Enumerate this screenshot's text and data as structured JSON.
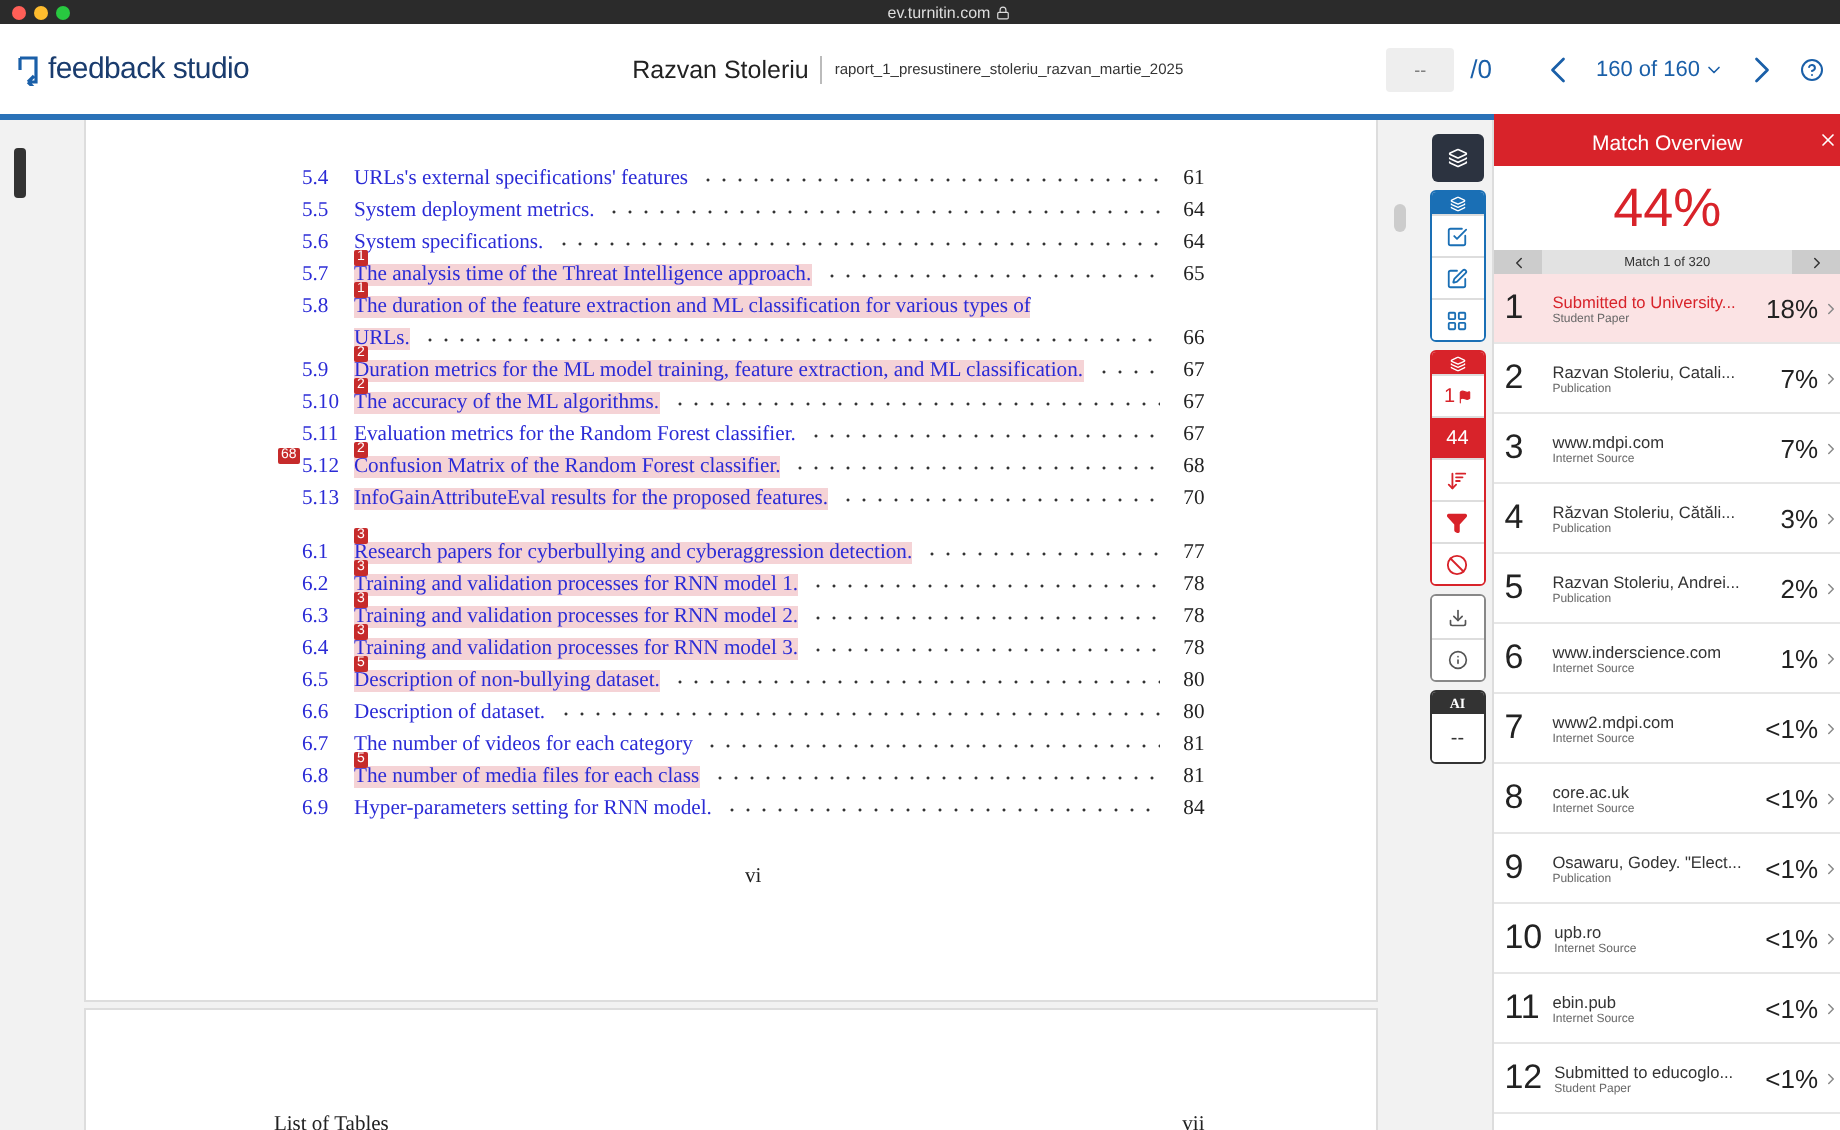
{
  "browser": {
    "url": "ev.turnitin.com"
  },
  "header": {
    "logo": "feedback studio",
    "author": "Razvan Stoleriu",
    "file": "raport_1_presustinere_stoleriu_razvan_martie_2025",
    "page_field": "--",
    "page_total": "/0",
    "paper_counter": "160 of 160"
  },
  "document": {
    "sections": [
      {
        "rows": [
          {
            "number": "5.4",
            "title": "URLs's external specifications' features",
            "page": "61",
            "highlighted": false
          },
          {
            "number": "5.5",
            "title": "System deployment metrics.",
            "page": "64",
            "highlighted": false
          },
          {
            "number": "5.6",
            "title": "System specifications.",
            "page": "64",
            "highlighted": false
          },
          {
            "number": "5.7",
            "title": "The analysis time of the Threat Intelligence approach.",
            "page": "65",
            "highlighted": true,
            "badges": [
              "1"
            ]
          },
          {
            "number": "5.8",
            "title": "The duration of the feature extraction and ML classification for various types of",
            "continuation": "URLs.",
            "page": "66",
            "highlighted": true,
            "badges": [
              "1"
            ]
          },
          {
            "number": "5.9",
            "title": "Duration metrics for the ML model training, feature extraction, and ML classification.",
            "page": "67",
            "highlighted": true,
            "badges": [
              "2"
            ]
          },
          {
            "number": "5.10",
            "title": "The accuracy of the ML algorithms.",
            "page": "67",
            "highlighted": true,
            "badges": [
              "2"
            ]
          },
          {
            "number": "5.11",
            "title": "Evaluation metrics for the Random Forest classifier.",
            "page": "67",
            "highlighted": false
          },
          {
            "number": "5.12",
            "title": "Confusion Matrix of the Random Forest classifier.",
            "page": "68",
            "highlighted": true,
            "number_badge": "68",
            "badges": [
              "2"
            ]
          },
          {
            "number": "5.13",
            "title": "InfoGainAttributeEval results for the proposed features.",
            "page": "70",
            "highlighted": true
          }
        ]
      },
      {
        "rows": [
          {
            "number": "6.1",
            "title": "Research papers for cyberbullying and cyberaggression detection.",
            "page": "77",
            "highlighted": true,
            "badges": [
              "3"
            ]
          },
          {
            "number": "6.2",
            "title": "Training and validation processes for RNN model 1.",
            "page": "78",
            "highlighted": true,
            "badges": [
              "3"
            ]
          },
          {
            "number": "6.3",
            "title": "Training and validation processes for RNN model 2.",
            "page": "78",
            "highlighted": true,
            "badges": [
              "3"
            ]
          },
          {
            "number": "6.4",
            "title": "Training and validation processes for RNN model 3.",
            "page": "78",
            "highlighted": true,
            "badges": [
              "3"
            ]
          },
          {
            "number": "6.5",
            "title": "Description of non-bullying dataset.",
            "page": "80",
            "highlighted": true,
            "badges": [
              "5"
            ]
          },
          {
            "number": "6.6",
            "title": "Description of dataset.",
            "page": "80",
            "highlighted": false
          },
          {
            "number": "6.7",
            "title": "The number of videos for each category",
            "page": "81",
            "highlighted": false
          },
          {
            "number": "6.8",
            "title": "The number of media files for each class",
            "page": "81",
            "highlighted": true,
            "badges": [
              "5"
            ]
          },
          {
            "number": "6.9",
            "title": "Hyper-parameters setting for RNN model.",
            "page": "84",
            "highlighted": false
          }
        ]
      }
    ],
    "page_number": "vi",
    "next_page": {
      "running_head": "List of Tables",
      "page_number": "vii"
    }
  },
  "toolbar": {
    "flag_count": "1",
    "similarity": "44",
    "ai_label": "AI",
    "ai_score": "--"
  },
  "match_overview": {
    "title": "Match Overview",
    "score": "44%",
    "pager": "Match 1 of 320",
    "matches": [
      {
        "rank": "1",
        "name": "Submitted to University...",
        "type": "Student Paper",
        "percent": "18%",
        "selected": true
      },
      {
        "rank": "2",
        "name": "Razvan Stoleriu, Catali...",
        "type": "Publication",
        "percent": "7%",
        "selected": false
      },
      {
        "rank": "3",
        "name": "www.mdpi.com",
        "type": "Internet Source",
        "percent": "7%",
        "selected": false
      },
      {
        "rank": "4",
        "name": "Răzvan Stoleriu, Cătăli...",
        "type": "Publication",
        "percent": "3%",
        "selected": false
      },
      {
        "rank": "5",
        "name": "Razvan Stoleriu, Andrei...",
        "type": "Publication",
        "percent": "2%",
        "selected": false
      },
      {
        "rank": "6",
        "name": "www.inderscience.com",
        "type": "Internet Source",
        "percent": "1%",
        "selected": false
      },
      {
        "rank": "7",
        "name": "www2.mdpi.com",
        "type": "Internet Source",
        "percent": "<1%",
        "selected": false
      },
      {
        "rank": "8",
        "name": "core.ac.uk",
        "type": "Internet Source",
        "percent": "<1%",
        "selected": false
      },
      {
        "rank": "9",
        "name": "Osawaru, Godey. \"Elect...",
        "type": "Publication",
        "percent": "<1%",
        "selected": false
      },
      {
        "rank": "10",
        "name": "upb.ro",
        "type": "Internet Source",
        "percent": "<1%",
        "selected": false
      },
      {
        "rank": "11",
        "name": "ebin.pub",
        "type": "Internet Source",
        "percent": "<1%",
        "selected": false
      },
      {
        "rank": "12",
        "name": "Submitted to educoglo...",
        "type": "Student Paper",
        "percent": "<1%",
        "selected": false
      }
    ]
  }
}
